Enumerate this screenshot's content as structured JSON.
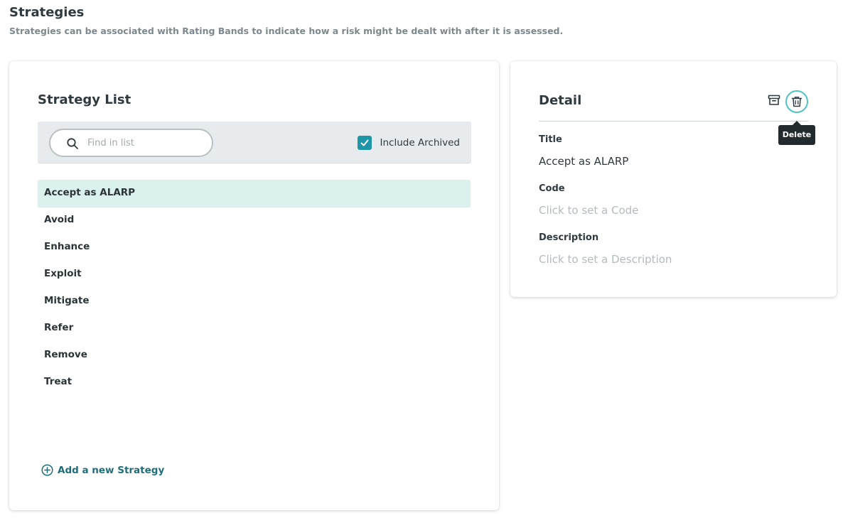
{
  "header": {
    "title": "Strategies",
    "subtitle": "Strategies can be associated with Rating Bands to indicate how a risk might be dealt with after it is assessed."
  },
  "list_panel": {
    "title": "Strategy List",
    "search": {
      "placeholder": "Find in list",
      "value": "",
      "icon": "search-icon"
    },
    "include_archived": {
      "label": "Include Archived",
      "checked": true
    },
    "items": [
      {
        "label": "Accept as ALARP",
        "selected": true
      },
      {
        "label": "Avoid",
        "selected": false
      },
      {
        "label": "Enhance",
        "selected": false
      },
      {
        "label": "Exploit",
        "selected": false
      },
      {
        "label": "Mitigate",
        "selected": false
      },
      {
        "label": "Refer",
        "selected": false
      },
      {
        "label": "Remove",
        "selected": false
      },
      {
        "label": "Treat",
        "selected": false
      }
    ],
    "add_label": "Add a new Strategy",
    "add_icon": "plus-circle-icon"
  },
  "detail_panel": {
    "title": "Detail",
    "archive_icon": "archive-icon",
    "delete_icon": "trash-icon",
    "delete_tooltip": "Delete",
    "fields": [
      {
        "label": "Title",
        "value": "Accept as ALARP",
        "is_placeholder": false
      },
      {
        "label": "Code",
        "value": "Click to set a Code",
        "is_placeholder": true
      },
      {
        "label": "Description",
        "value": "Click to set a Description",
        "is_placeholder": true
      }
    ]
  },
  "colors": {
    "accent": "#1e96a8",
    "selected_row": "#dbf1ee",
    "link": "#1f6e7b",
    "delete_ring": "#4fc3c6",
    "tooltip_bg": "#232b2e"
  }
}
